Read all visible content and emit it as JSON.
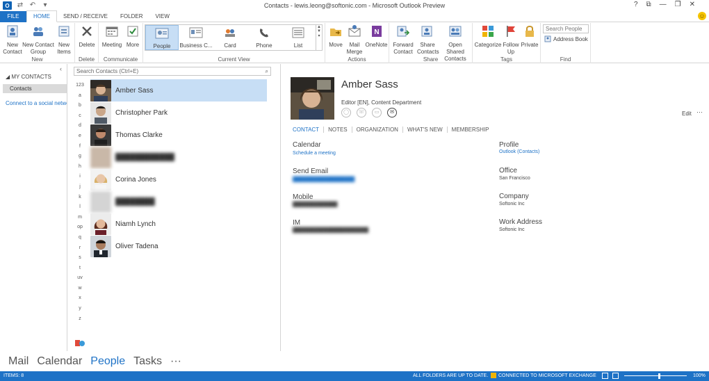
{
  "window": {
    "title": "Contacts - lewis.leong@softonic.com - Microsoft Outlook Preview",
    "controls": [
      "?",
      "⧉",
      "—",
      "❐",
      "✕"
    ]
  },
  "tabs": [
    "FILE",
    "HOME",
    "SEND / RECEIVE",
    "FOLDER",
    "VIEW"
  ],
  "ribbon": {
    "new_group": {
      "label": "New",
      "new_contact": "New Contact",
      "new_contact_group": "New Contact Group",
      "new_items": "New Items"
    },
    "delete_group": {
      "label": "Delete",
      "delete": "Delete"
    },
    "communicate_group": {
      "label": "Communicate",
      "meeting": "Meeting",
      "more": "More"
    },
    "current_view": {
      "label": "Current View",
      "views": [
        "People",
        "Business C...",
        "Card",
        "Phone",
        "List"
      ],
      "selected": "People"
    },
    "actions_group": {
      "label": "Actions",
      "move": "Move",
      "mail_merge": "Mail Merge",
      "onenote": "OneNote"
    },
    "share_group": {
      "label": "Share",
      "forward_contact": "Forward Contact",
      "share_contacts": "Share Contacts",
      "open_shared": "Open Shared Contacts"
    },
    "tags_group": {
      "label": "Tags",
      "categorize": "Categorize",
      "follow_up": "Follow Up",
      "private": "Private"
    },
    "find_group": {
      "label": "Find",
      "search_placeholder": "Search People",
      "address_book": "Address Book"
    }
  },
  "leftnav": {
    "header": "MY CONTACTS",
    "folder": "Contacts",
    "connect": "Connect to a social network"
  },
  "list": {
    "search_placeholder": "Search Contacts (Ctrl+E)",
    "alpha": [
      "123",
      "a",
      "b",
      "c",
      "d",
      "e",
      "f",
      "g",
      "h",
      "i",
      "j",
      "k",
      "l",
      "m",
      "op",
      "q",
      "r",
      "s",
      "t",
      "uv",
      "w",
      "x",
      "y",
      "z"
    ],
    "contacts": [
      {
        "name": "Amber Sass",
        "selected": true
      },
      {
        "name": "Christopher Park"
      },
      {
        "name": "Thomas Clarke"
      },
      {
        "name": "",
        "blurred": true
      },
      {
        "name": "Corina Jones"
      },
      {
        "name": "",
        "blurred": true
      },
      {
        "name": "Niamh Lynch"
      },
      {
        "name": "Oliver Tadena"
      }
    ]
  },
  "reading": {
    "name": "Amber Sass",
    "title": "Editor [EN], Content Department",
    "edit": "Edit",
    "more": "···",
    "tabs": [
      "CONTACT",
      "NOTES",
      "ORGANIZATION",
      "WHAT'S NEW",
      "MEMBERSHIP"
    ],
    "left_fields": {
      "calendar_label": "Calendar",
      "calendar_value": "Schedule a meeting",
      "email_label": "Send Email",
      "mobile_label": "Mobile",
      "im_label": "IM"
    },
    "right_fields": {
      "profile_label": "Profile",
      "profile_value": "Outlook (Contacts)",
      "office_label": "Office",
      "office_value": "San Francisco",
      "company_label": "Company",
      "company_value": "Softonic Inc",
      "work_label": "Work Address",
      "work_value": "Softonic Inc"
    }
  },
  "navbar": {
    "items": [
      "Mail",
      "Calendar",
      "People",
      "Tasks",
      "···"
    ],
    "active": "People"
  },
  "status": {
    "items": "ITEMS: 8",
    "uptodate": "ALL FOLDERS ARE UP TO DATE.",
    "exchange": "CONNECTED TO MICROSOFT EXCHANGE",
    "zoom": "100%",
    "zoom_level": 0.55
  },
  "colors": {
    "accent": "#1e72c6",
    "selection": "#c7def5",
    "status_bar": "#1e72c6"
  }
}
